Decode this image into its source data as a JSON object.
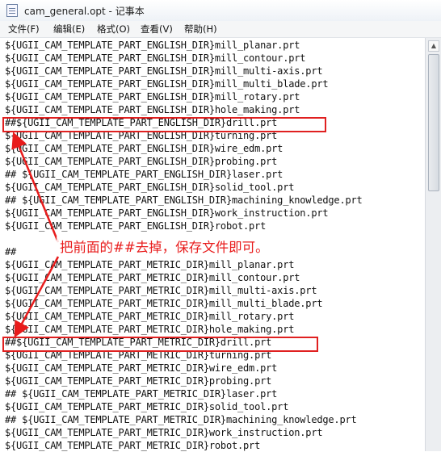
{
  "window": {
    "title": "cam_general.opt - 记事本"
  },
  "menu": [
    {
      "label": "文件(F)"
    },
    {
      "label": "编辑(E)"
    },
    {
      "label": "格式(O)"
    },
    {
      "label": "查看(V)"
    },
    {
      "label": "帮助(H)"
    }
  ],
  "lines": [
    "${UGII_CAM_TEMPLATE_PART_ENGLISH_DIR}mill_planar.prt",
    "${UGII_CAM_TEMPLATE_PART_ENGLISH_DIR}mill_contour.prt",
    "${UGII_CAM_TEMPLATE_PART_ENGLISH_DIR}mill_multi-axis.prt",
    "${UGII_CAM_TEMPLATE_PART_ENGLISH_DIR}mill_multi_blade.prt",
    "${UGII_CAM_TEMPLATE_PART_ENGLISH_DIR}mill_rotary.prt",
    "${UGII_CAM_TEMPLATE_PART_ENGLISH_DIR}hole_making.prt",
    "##${UGII_CAM_TEMPLATE_PART_ENGLISH_DIR}drill.prt",
    "${UGII_CAM_TEMPLATE_PART_ENGLISH_DIR}turning.prt",
    "${UGII_CAM_TEMPLATE_PART_ENGLISH_DIR}wire_edm.prt",
    "${UGII_CAM_TEMPLATE_PART_ENGLISH_DIR}probing.prt",
    "## ${UGII_CAM_TEMPLATE_PART_ENGLISH_DIR}laser.prt",
    "${UGII_CAM_TEMPLATE_PART_ENGLISH_DIR}solid_tool.prt",
    "## ${UGII_CAM_TEMPLATE_PART_ENGLISH_DIR}machining_knowledge.prt",
    "${UGII_CAM_TEMPLATE_PART_ENGLISH_DIR}work_instruction.prt",
    "${UGII_CAM_TEMPLATE_PART_ENGLISH_DIR}robot.prt",
    "",
    "##",
    "${UGII_CAM_TEMPLATE_PART_METRIC_DIR}mill_planar.prt",
    "${UGII_CAM_TEMPLATE_PART_METRIC_DIR}mill_contour.prt",
    "${UGII_CAM_TEMPLATE_PART_METRIC_DIR}mill_multi-axis.prt",
    "${UGII_CAM_TEMPLATE_PART_METRIC_DIR}mill_multi_blade.prt",
    "${UGII_CAM_TEMPLATE_PART_METRIC_DIR}mill_rotary.prt",
    "${UGII_CAM_TEMPLATE_PART_METRIC_DIR}hole_making.prt",
    "##${UGII_CAM_TEMPLATE_PART_METRIC_DIR}drill.prt",
    "${UGII_CAM_TEMPLATE_PART_METRIC_DIR}turning.prt",
    "${UGII_CAM_TEMPLATE_PART_METRIC_DIR}wire_edm.prt",
    "${UGII_CAM_TEMPLATE_PART_METRIC_DIR}probing.prt",
    "## ${UGII_CAM_TEMPLATE_PART_METRIC_DIR}laser.prt",
    "${UGII_CAM_TEMPLATE_PART_METRIC_DIR}solid_tool.prt",
    "## ${UGII_CAM_TEMPLATE_PART_METRIC_DIR}machining_knowledge.prt",
    "${UGII_CAM_TEMPLATE_PART_METRIC_DIR}work_instruction.prt",
    "${UGII_CAM_TEMPLATE_PART_METRIC_DIR}robot.prt"
  ],
  "annotation": {
    "text": "把前面的##去掉，保存文件即可。",
    "color": "#e81c1c"
  },
  "icons": {
    "app": "notepad-icon",
    "scroll_up": "scroll-up-arrow-icon"
  }
}
